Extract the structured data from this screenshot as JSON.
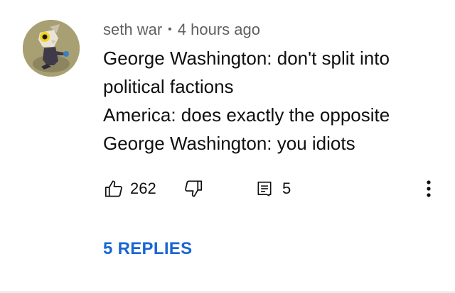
{
  "comment": {
    "author": "seth war",
    "separator": "•",
    "time": "4 hours ago",
    "lines": [
      "George Washington: don't split into",
      "political factions",
      "America: does exactly the opposite",
      "George Washington: you idiots"
    ],
    "like_count": "262",
    "reply_count": "5",
    "replies_link": "5 REPLIES"
  },
  "icons": {
    "like": "thumbs-up-icon",
    "dislike": "thumbs-down-icon",
    "reply": "comment-reply-icon",
    "more": "more-vertical-icon"
  },
  "colors": {
    "link": "#1a66d2",
    "meta_text": "#606060",
    "body_text": "#0f0f0f"
  }
}
